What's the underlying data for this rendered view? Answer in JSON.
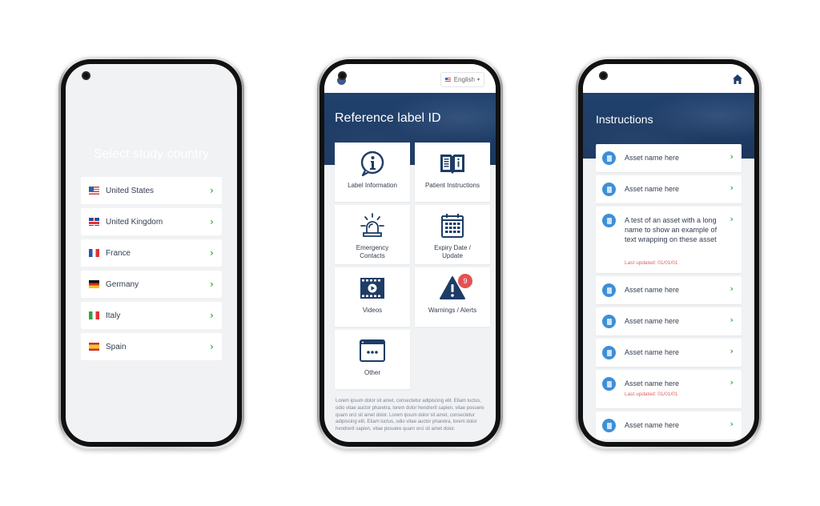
{
  "country_screen": {
    "title": "Select study country",
    "countries": [
      {
        "label": "United States",
        "flag": "us"
      },
      {
        "label": "United Kingdom",
        "flag": "uk"
      },
      {
        "label": "France",
        "flag": "fr"
      },
      {
        "label": "Germany",
        "flag": "de"
      },
      {
        "label": "Italy",
        "flag": "it"
      },
      {
        "label": "Spain",
        "flag": "es"
      }
    ],
    "chevron": "›"
  },
  "home_screen": {
    "language": "English",
    "language_caret": "▾",
    "title": "Reference label ID",
    "tiles": [
      {
        "label": "Label Information",
        "icon": "info-bubble-icon"
      },
      {
        "label": "Patient Instructions",
        "icon": "book-icon"
      },
      {
        "label": "Emergency Contacts",
        "icon": "siren-icon"
      },
      {
        "label": "Expiry Date / Update",
        "icon": "calendar-icon"
      },
      {
        "label": "Videos",
        "icon": "video-icon"
      },
      {
        "label": "Warnings / Alerts",
        "icon": "warning-icon",
        "badge": "9"
      },
      {
        "label": "Other",
        "icon": "window-dots-icon"
      }
    ],
    "footer_text": "Lorem ipsum dolor sit amet, consectetur adipiscing elit. Etiam luctus, odio vitae auctor pharetra, lorem dolor hendrerit sapien, vitae posuere quam orci sit amet dolor. Lorem ipsum dolor sit amet, consectetur adipiscing elit. Etiam luctus, odio vitae auctor pharetra, lorem dolor hendrerit sapien, vitae posuere quam orci sit amet dolor."
  },
  "instructions_screen": {
    "title": "Instructions",
    "assets": [
      {
        "name": "Asset name here",
        "updated": ""
      },
      {
        "name": "Asset name here",
        "updated": ""
      },
      {
        "name": "A test of an asset with a long name to show an example of text wrapping on these asset",
        "updated": "Last updated: 01/01/01"
      },
      {
        "name": "Asset name here",
        "updated": ""
      },
      {
        "name": "Asset name here",
        "updated": ""
      },
      {
        "name": "Asset name here",
        "updated": ""
      },
      {
        "name": "Asset name here",
        "updated": "Last updated: 01/01/01"
      },
      {
        "name": "Asset name here",
        "updated": ""
      }
    ]
  },
  "colors": {
    "brand_navy": "#1e3c66",
    "chevron_green": "#4caf50",
    "doc_icon_blue": "#3f8fd6",
    "badge_red": "#e25252",
    "updated_red": "#e06060"
  }
}
